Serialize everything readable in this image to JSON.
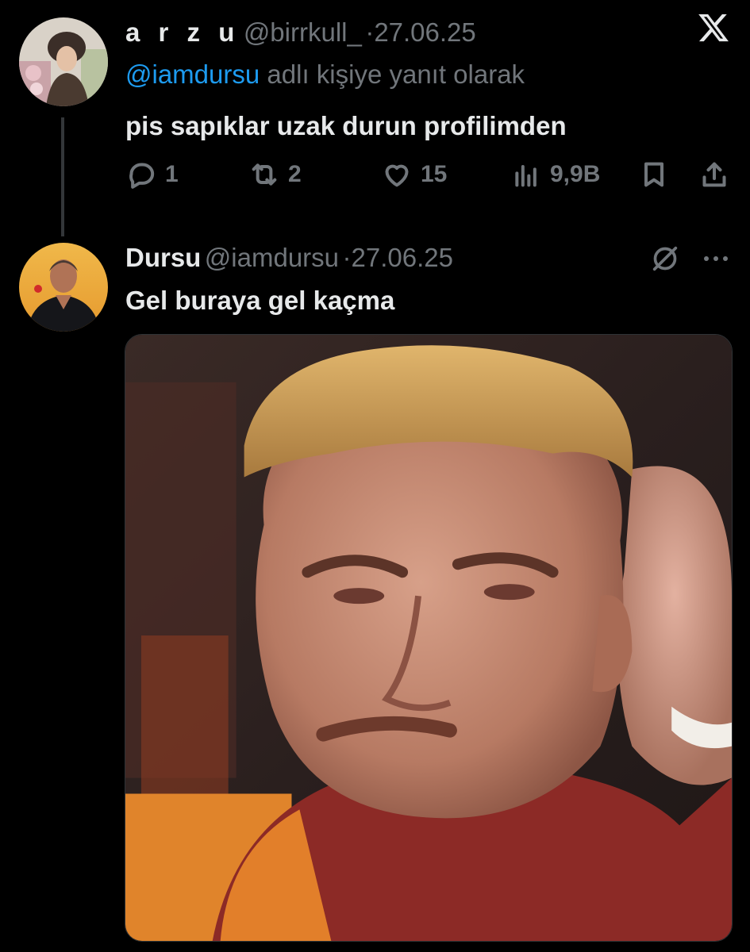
{
  "app": {
    "logo_icon": "x-logo-icon"
  },
  "parent_tweet": {
    "display_name": "a r z u",
    "handle": "@birrkull_",
    "separator": "·",
    "date": "27.06.25",
    "reply_to_mention": "@iamdursu",
    "reply_to_suffix": " adlı kişiye yanıt olarak",
    "text": "pis sapıklar uzak durun profilimden",
    "actions": {
      "replies": "1",
      "reposts": "2",
      "likes": "15",
      "views": "9,9B"
    }
  },
  "reply_tweet": {
    "display_name": "Dursu",
    "handle": "@iamdursu",
    "separator": "·",
    "date": "27.06.25",
    "text": "Gel buraya gel kaçma",
    "media_description_icon": "photo"
  },
  "colors": {
    "background": "#000000",
    "text_primary": "#e7e9ea",
    "text_secondary": "#71767b",
    "link": "#1d9bf0"
  }
}
